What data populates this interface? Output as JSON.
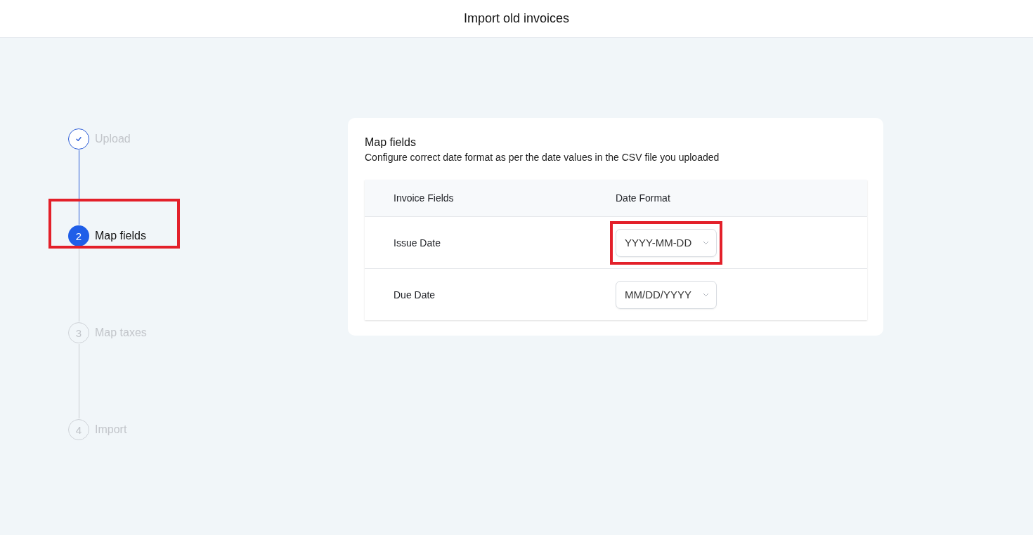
{
  "header": {
    "title": "Import old invoices"
  },
  "steps": [
    {
      "label": "Upload",
      "kind": "done",
      "highlighted": false
    },
    {
      "number": "2",
      "label": "Map fields",
      "kind": "current",
      "highlighted": true
    },
    {
      "number": "3",
      "label": "Map taxes",
      "kind": "pending",
      "highlighted": false
    },
    {
      "number": "4",
      "label": "Import",
      "kind": "pending",
      "highlighted": false
    }
  ],
  "card": {
    "title": "Map fields",
    "subtitle": "Configure correct date format as per the date values in the CSV file you uploaded",
    "table": {
      "columns": [
        "Invoice Fields",
        "Date Format"
      ],
      "rows": [
        {
          "field": "Issue Date",
          "format": "YYYY-MM-DD",
          "highlighted": true
        },
        {
          "field": "Due Date",
          "format": "MM/DD/YYYY",
          "highlighted": false
        }
      ]
    }
  }
}
